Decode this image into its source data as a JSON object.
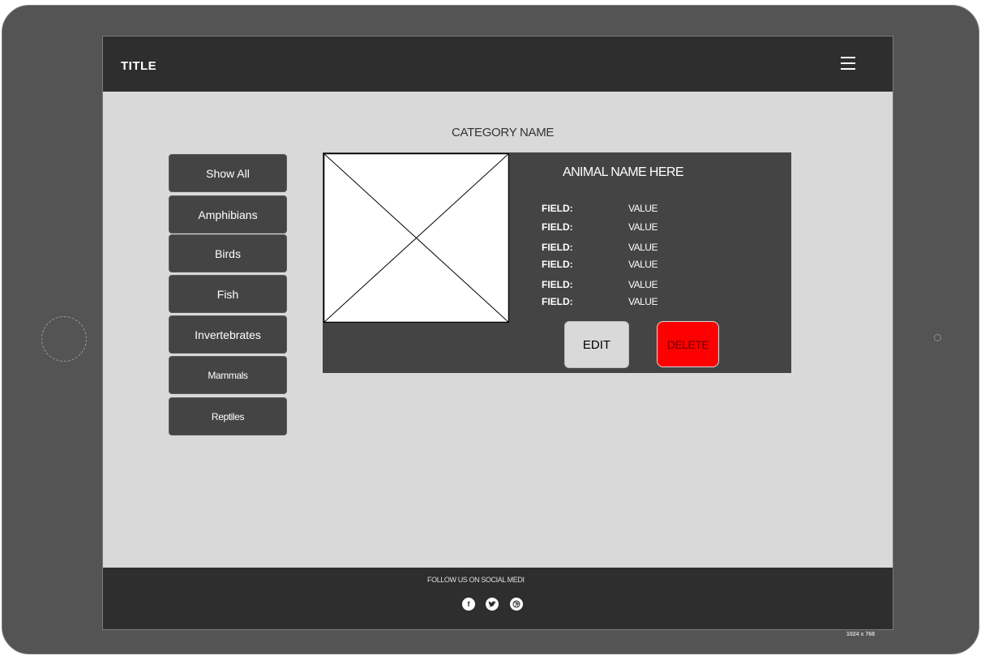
{
  "header": {
    "title": "TITLE"
  },
  "category": {
    "title": "CATEGORY NAME"
  },
  "sidebar": {
    "items": [
      {
        "label": "Show All"
      },
      {
        "label": "Amphibians"
      },
      {
        "label": "Birds"
      },
      {
        "label": "Fish"
      },
      {
        "label": "Invertebrates"
      },
      {
        "label": "Mammals"
      },
      {
        "label": "Reptiles"
      }
    ]
  },
  "card": {
    "animal_name": "ANIMAL NAME HERE",
    "fields": [
      {
        "label": "FIELD:",
        "value": "VALUE"
      },
      {
        "label": "FIELD:",
        "value": "VALUE"
      },
      {
        "label": "FIELD:",
        "value": "VALUE"
      },
      {
        "label": "FIELD:",
        "value": "VALUE"
      },
      {
        "label": "FIELD:",
        "value": "VALUE"
      },
      {
        "label": "FIELD:",
        "value": "VALUE"
      }
    ],
    "edit_label": "EDIT",
    "delete_label": "DELETE"
  },
  "footer": {
    "text": "FOLLOW US ON SOCIAL MEDI",
    "social_icons": [
      "facebook-icon",
      "twitter-icon",
      "dribbble-icon"
    ]
  },
  "device": {
    "size_label": "1024 x 768"
  },
  "colors": {
    "header_bg": "#2e2e2e",
    "panel_bg": "#444444",
    "delete_bg": "#ff0000",
    "screen_bg": "#d9d9d9"
  }
}
